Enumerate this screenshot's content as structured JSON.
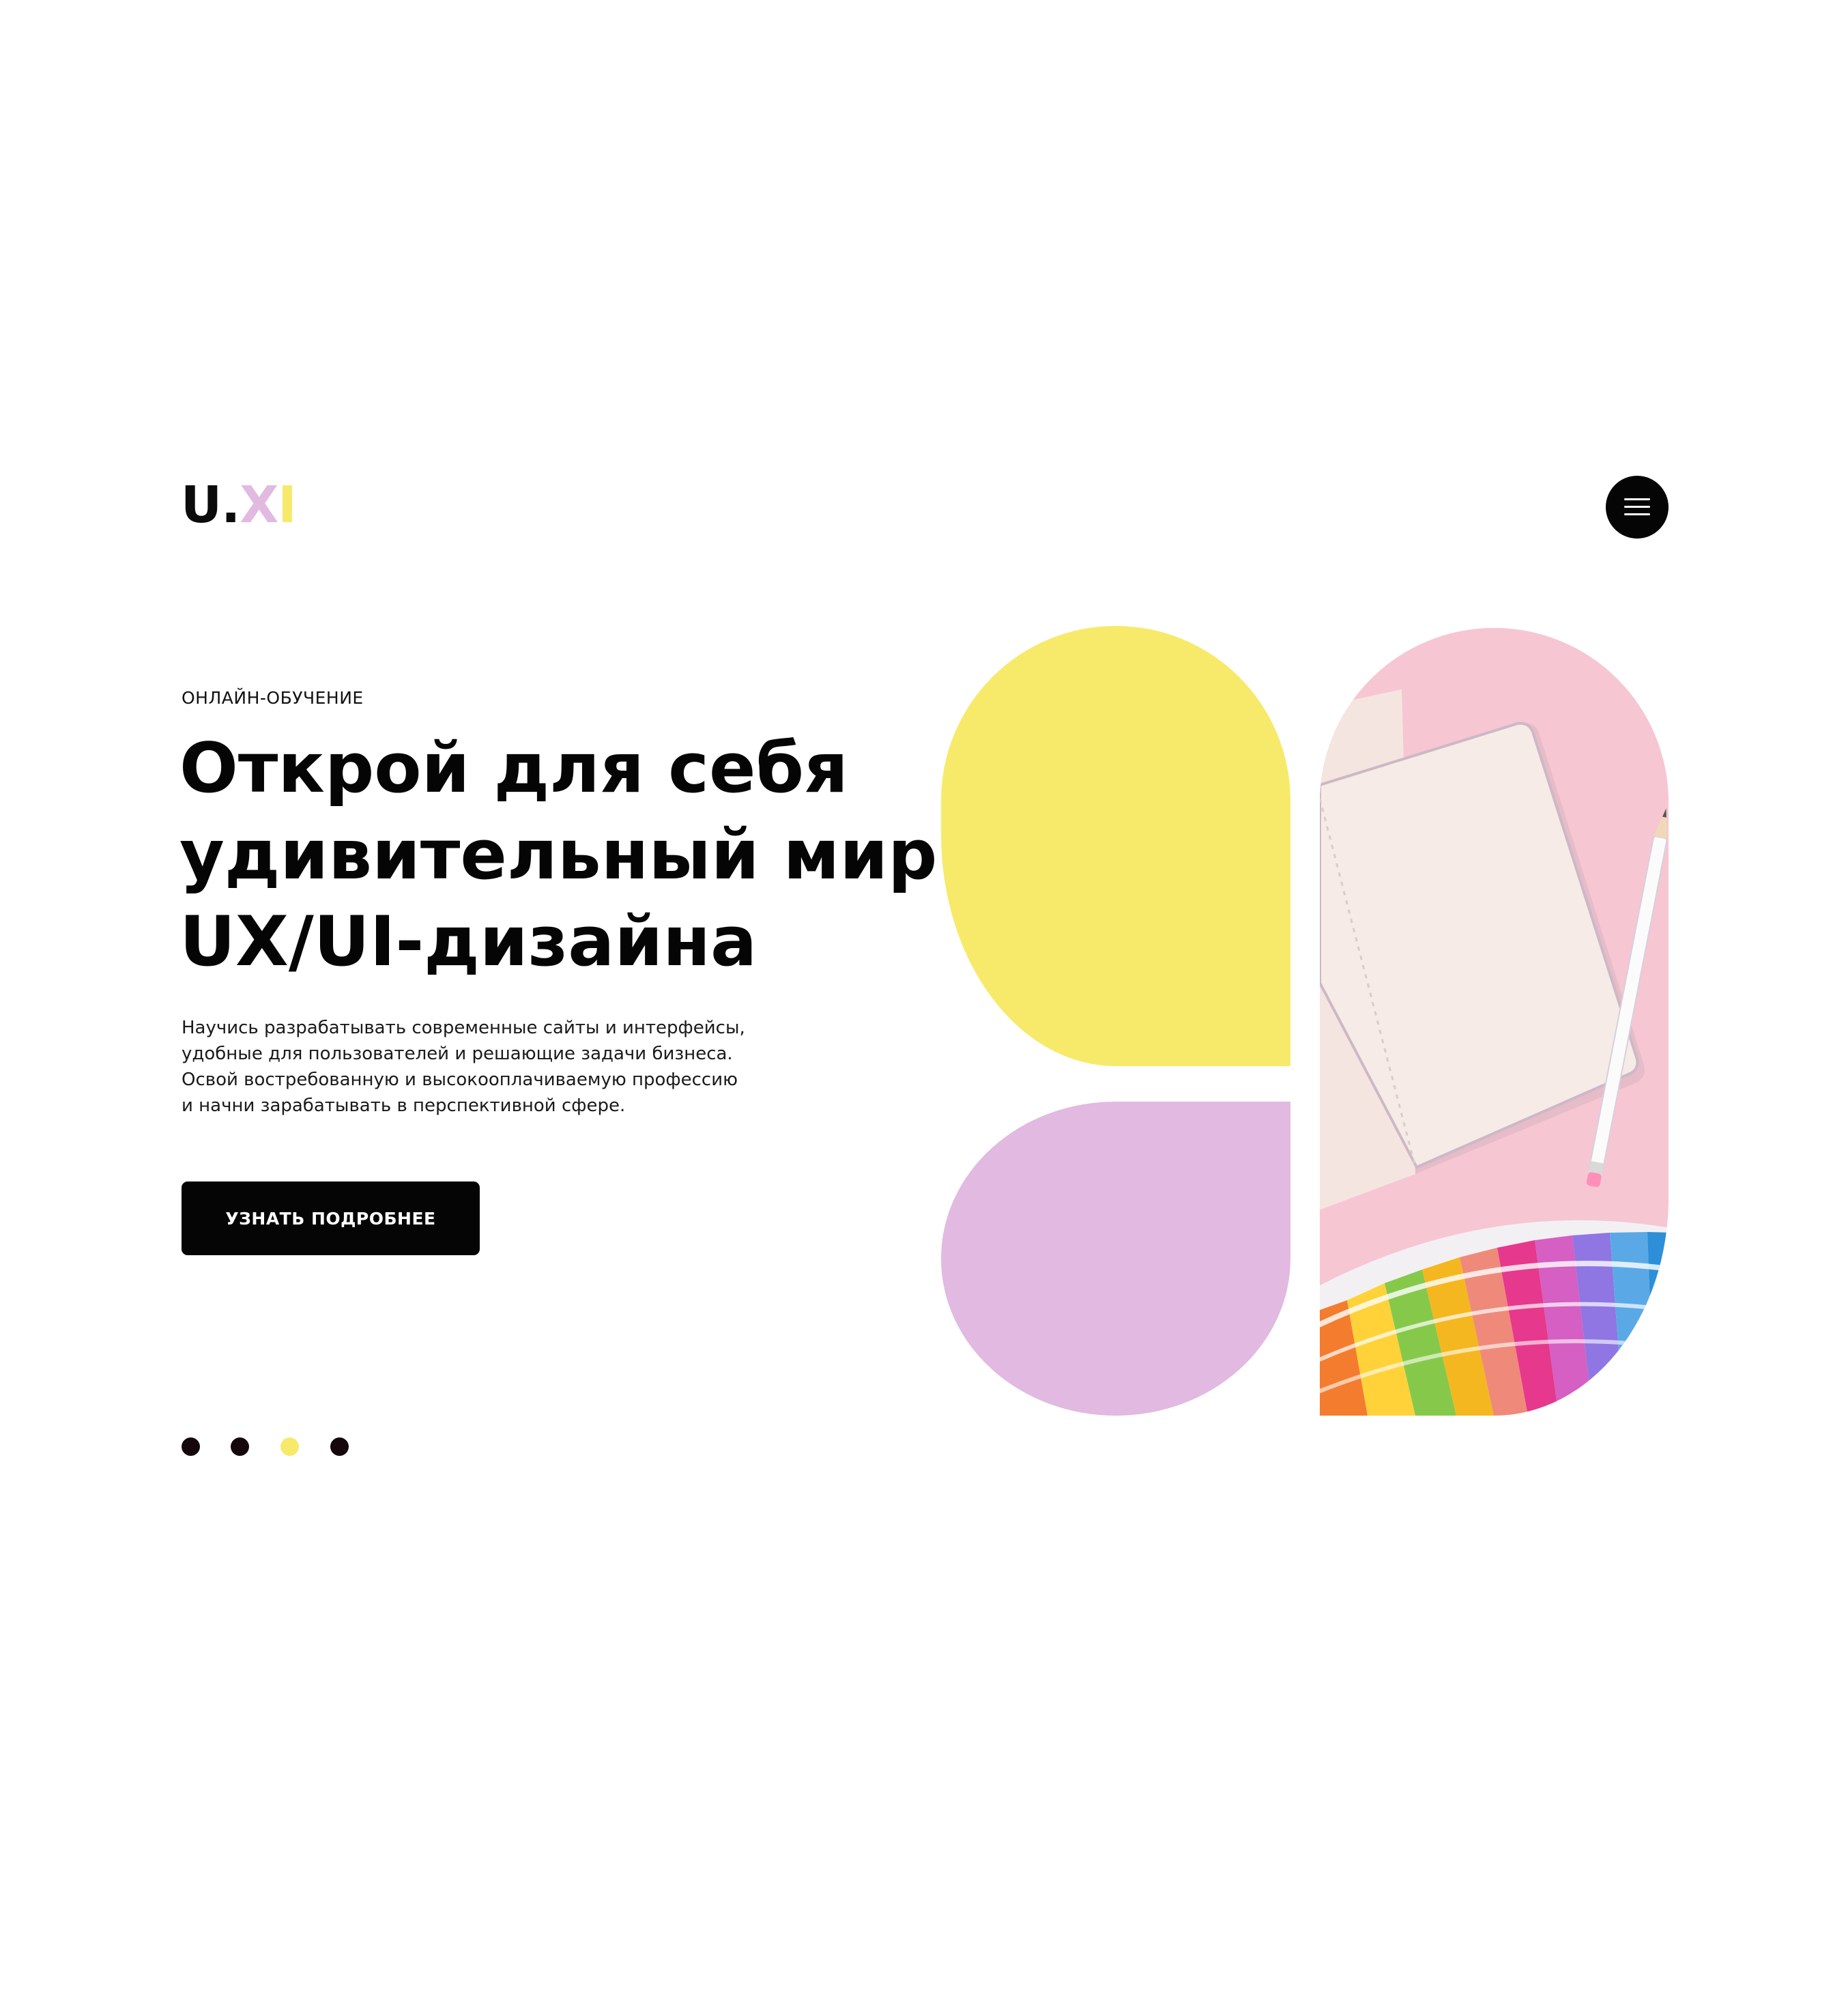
{
  "logo": {
    "part1": "U.",
    "part2": "X",
    "part3": "I",
    "colors": {
      "x": "#e1b9e1",
      "i": "#f7ea6b"
    }
  },
  "header": {
    "menu_icon": "hamburger-menu-icon"
  },
  "hero": {
    "eyebrow": "ОНЛАЙН-ОБУЧЕНИЕ",
    "title_lines": [
      "Открой для себя",
      "удивительный мир",
      "UX/UI-дизайна"
    ],
    "description_lines": [
      "Научись разрабатывать современные сайты и интерфейсы,",
      "удобные для пользователей и решающие задачи бизнеса.",
      "Освой востребованную и высокооплачиваемую профессию",
      "и начни зарабатывать в перспективной сфере."
    ],
    "cta_label": "УЗНАТЬ ПОДРОБНЕЕ"
  },
  "slider": {
    "count": 4,
    "active_index": 2,
    "active_color": "#f7ea6b",
    "inactive_color": "#14060a"
  },
  "colors": {
    "yellow": "#f7ea6b",
    "lilac": "#e1b9e1",
    "pink": "#f7c6d3",
    "black": "#050505"
  }
}
